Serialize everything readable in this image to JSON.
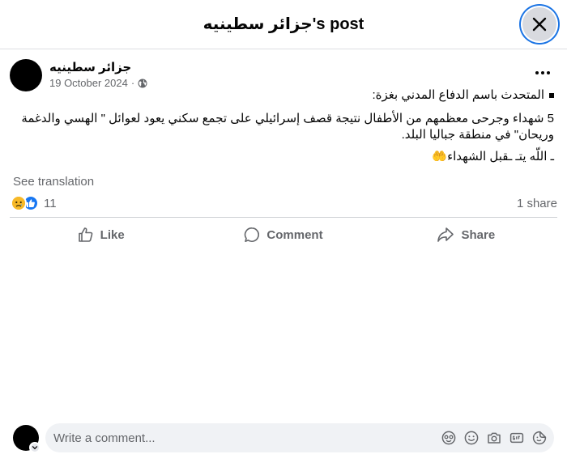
{
  "header": {
    "title": "جزائر سطينيه's post",
    "close_icon": "close-icon"
  },
  "post": {
    "author": "جزائر سطينيه",
    "date": "19 October 2024",
    "separator": "·",
    "privacy_icon": "globe-icon",
    "paragraphs": [
      "المتحدث باسم الدفاع المدني بغزة:",
      "5 شهداء وجرحى معظمهم من الأطفال نتيجة قصف إسرائيلي على تجمع سكني يعود لعوائل \" الهسي والدغمة وريحان\" في منطقة جباليا البلد.",
      "ـ اللّه يتـ ـقبل الشهداء🤲"
    ],
    "see_translation": "See translation"
  },
  "stats": {
    "reaction_count": "11",
    "shares": "1 share",
    "reaction_icons": [
      "sad-icon",
      "like-icon"
    ]
  },
  "actions": {
    "like": "Like",
    "comment": "Comment",
    "share": "Share"
  },
  "comment": {
    "placeholder": "Write a comment...",
    "tools": [
      "avatar-sticker-icon",
      "emoji-icon",
      "camera-icon",
      "gif-icon",
      "sticker-icon"
    ]
  },
  "colors": {
    "accent": "#1b74e4",
    "text_secondary": "#65676b",
    "comment_bg": "#f0f2f5"
  }
}
